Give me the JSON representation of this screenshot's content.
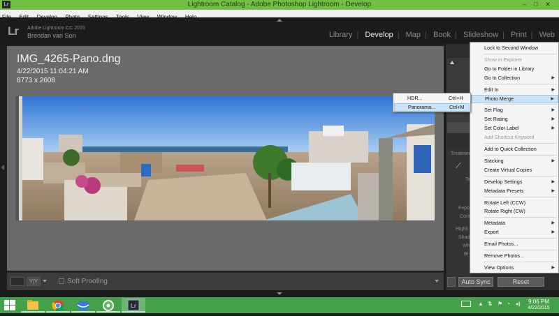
{
  "window": {
    "title": "Lightroom Catalog - Adobe Photoshop Lightroom - Develop",
    "app_icon": "Lr",
    "controls": [
      "–",
      "□",
      "✕"
    ]
  },
  "menubar": [
    "File",
    "Edit",
    "Develop",
    "Photo",
    "Settings",
    "Tools",
    "View",
    "Window",
    "Help"
  ],
  "identity": {
    "logo": "Lr",
    "version": "Adobe Lightroom CC 2015",
    "user": "Brendan van Son"
  },
  "modules": {
    "items": [
      "Library",
      "Develop",
      "Map",
      "Book",
      "Slideshow",
      "Print",
      "Web"
    ],
    "active": "Develop"
  },
  "photo_info": {
    "filename": "IMG_4265-Pano.dng",
    "datetime": "4/22/2015 11:04:21 AM",
    "dimensions": "8773 x 2608"
  },
  "toolbar": {
    "soft_proofing": "Soft Proofing"
  },
  "right_panel": {
    "treatment": "Treatmen",
    "auto_sync": "Auto Sync",
    "reset": "Reset",
    "labels": [
      "Te",
      "Expo",
      "Cont",
      "Highli",
      "Shad",
      "Wh",
      "Bl"
    ]
  },
  "context_menu": {
    "items": [
      {
        "label": "Lock to Second Window",
        "disabled": false,
        "submenu": false
      },
      {
        "sep": true
      },
      {
        "label": "Show in Explorer",
        "disabled": true,
        "submenu": false
      },
      {
        "label": "Go to Folder in Library",
        "disabled": false,
        "submenu": false
      },
      {
        "label": "Go to Collection",
        "disabled": false,
        "submenu": true
      },
      {
        "sep": true
      },
      {
        "label": "Edit In",
        "disabled": false,
        "submenu": true
      },
      {
        "label": "Photo Merge",
        "disabled": false,
        "submenu": true,
        "highlighted": true
      },
      {
        "sep": true
      },
      {
        "label": "Set Flag",
        "disabled": false,
        "submenu": true
      },
      {
        "label": "Set Rating",
        "disabled": false,
        "submenu": true
      },
      {
        "label": "Set Color Label",
        "disabled": false,
        "submenu": true
      },
      {
        "label": "Add Shortcut Keyword",
        "disabled": true,
        "submenu": false
      },
      {
        "sep": true
      },
      {
        "label": "Add to Quick Collection",
        "disabled": false,
        "submenu": false
      },
      {
        "sep": true
      },
      {
        "label": "Stacking",
        "disabled": false,
        "submenu": true
      },
      {
        "label": "Create Virtual Copies",
        "disabled": false,
        "submenu": false
      },
      {
        "sep": true
      },
      {
        "label": "Develop Settings",
        "disabled": false,
        "submenu": true
      },
      {
        "label": "Metadata Presets",
        "disabled": false,
        "submenu": true
      },
      {
        "sep": true
      },
      {
        "label": "Rotate Left (CCW)",
        "disabled": false,
        "submenu": false
      },
      {
        "label": "Rotate Right (CW)",
        "disabled": false,
        "submenu": false
      },
      {
        "sep": true
      },
      {
        "label": "Metadata",
        "disabled": false,
        "submenu": true
      },
      {
        "label": "Export",
        "disabled": false,
        "submenu": true
      },
      {
        "sep": true
      },
      {
        "label": "Email Photos...",
        "disabled": false,
        "submenu": false
      },
      {
        "sep": true
      },
      {
        "label": "Remove Photos...",
        "disabled": false,
        "submenu": false
      },
      {
        "sep": true
      },
      {
        "label": "View Options",
        "disabled": false,
        "submenu": true
      }
    ]
  },
  "photo_merge_submenu": [
    {
      "label": "HDR...",
      "shortcut": "Ctrl+H",
      "highlighted": false
    },
    {
      "label": "Panorama...",
      "shortcut": "Ctrl+M",
      "highlighted": true
    }
  ],
  "taskbar": {
    "time": "9:06 PM",
    "date": "4/22/2015",
    "apps": [
      "file-explorer",
      "chrome",
      "thunderbird",
      "picasa",
      "lightroom"
    ]
  }
}
